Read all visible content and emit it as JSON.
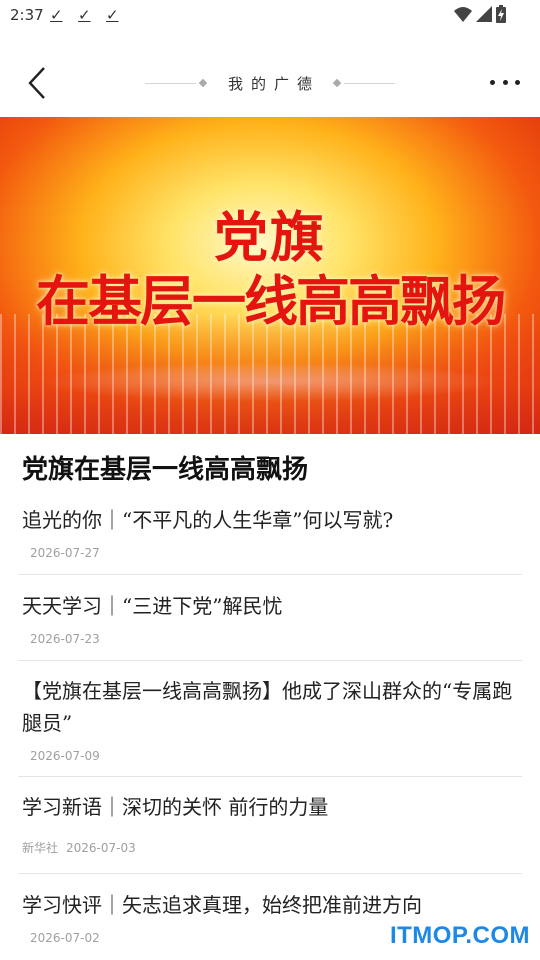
{
  "status_bar": {
    "time": "2:37",
    "icons": [
      "download-done-icon",
      "download-done-icon",
      "download-done-icon",
      "wifi-icon",
      "signal-icon",
      "battery-charging-icon"
    ]
  },
  "navbar": {
    "title": "我的广德",
    "back_icon": "back-chevron-icon",
    "more_icon": "more-dots-icon"
  },
  "banner": {
    "line1": "党旗",
    "line2": "在基层一线高高飘扬"
  },
  "section": {
    "title": "党旗在基层一线高高飘扬"
  },
  "articles": [
    {
      "title": "追光的你｜“不平凡的人生华章”何以写就?",
      "source": "",
      "date": "2026-07-27"
    },
    {
      "title": "天天学习｜“三进下党”解民忧",
      "source": "",
      "date": "2026-07-23"
    },
    {
      "title": "【党旗在基层一线高高飘扬】他成了深山群众的“专属跑腿员”",
      "source": "",
      "date": "2026-07-09"
    },
    {
      "title": "学习新语｜深切的关怀 前行的力量",
      "source": "新华社",
      "date": "2026-07-03"
    },
    {
      "title": "学习快评｜矢志追求真理，始终把准前进方向",
      "source": "",
      "date": "2026-07-02"
    }
  ],
  "watermark": "ITMOP.COM",
  "colors": {
    "banner_text": "#e4140f",
    "watermark": "#1e88e5",
    "meta": "#a0a0a0"
  }
}
